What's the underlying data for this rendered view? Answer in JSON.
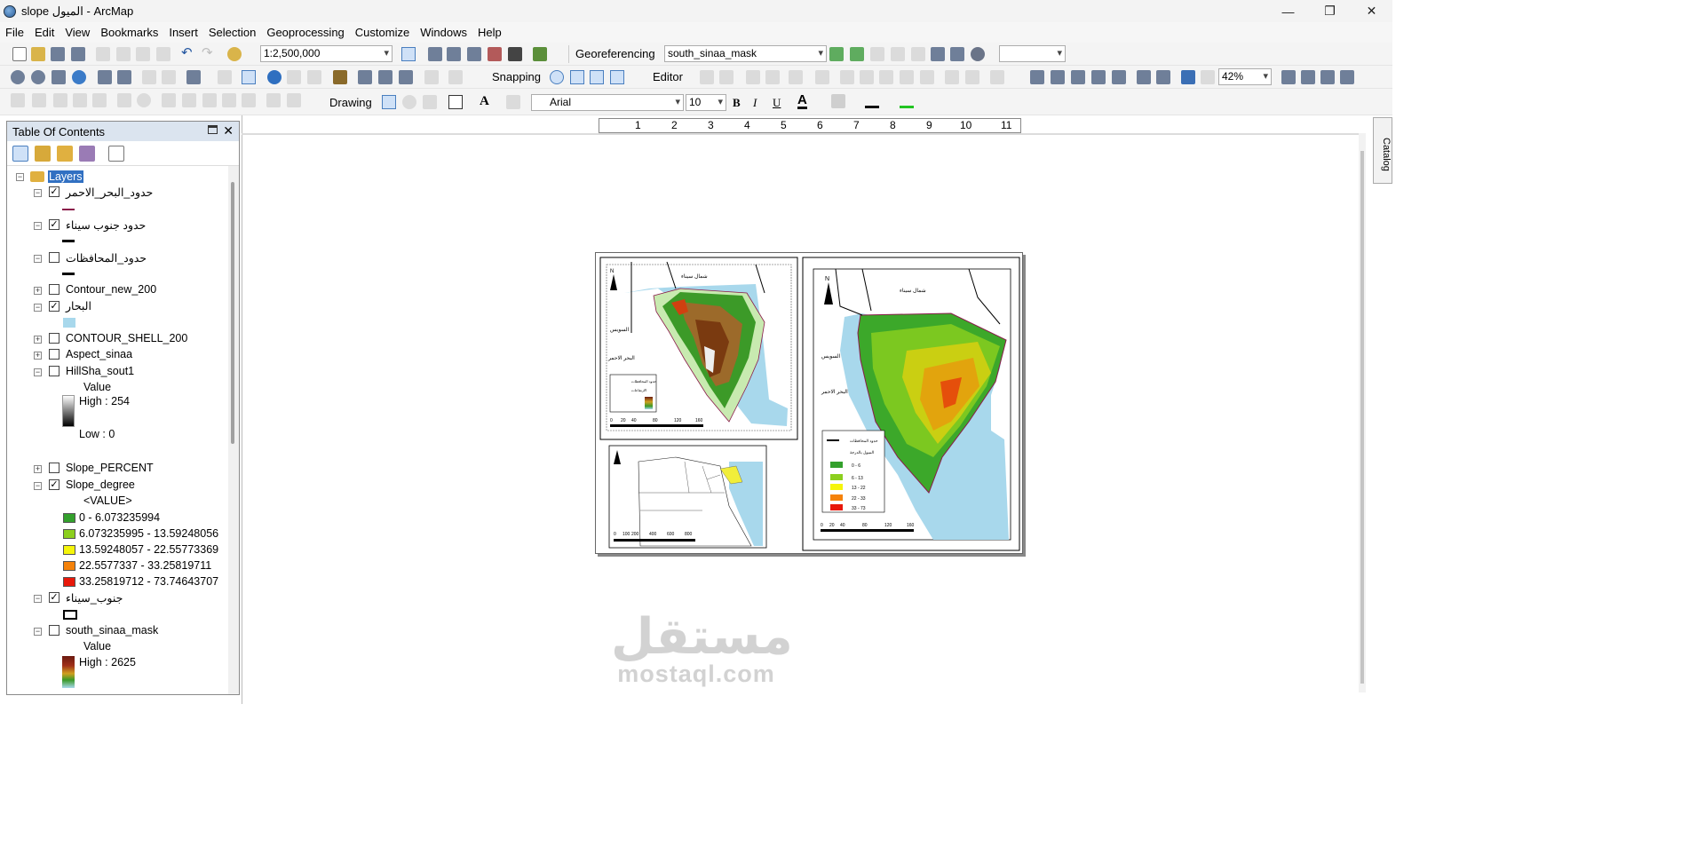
{
  "window": {
    "title": "slope الميول - ArcMap"
  },
  "menu": [
    "File",
    "Edit",
    "View",
    "Bookmarks",
    "Insert",
    "Selection",
    "Geoprocessing",
    "Customize",
    "Windows",
    "Help"
  ],
  "toolbar": {
    "scale": "1:2,500,000",
    "georef_label": "Georeferencing",
    "georef_layer": "south_sinaa_mask",
    "snapping_label": "Snapping",
    "editor_label": "Editor",
    "zoom": "42%",
    "drawing_label": "Drawing",
    "font_name": "Arial",
    "font_size": "10",
    "bold": "B",
    "italic": "I",
    "underline": "U",
    "text_a": "A"
  },
  "toc": {
    "title": "Table Of Contents",
    "root": "Layers",
    "layers": [
      {
        "name": "حدود_البحر_الاحمر",
        "checked": true,
        "expanded": true
      },
      {
        "name": "حدود جنوب سيناء",
        "checked": true,
        "expanded": true
      },
      {
        "name": "حدود_المحافظات",
        "checked": false,
        "expanded": true
      },
      {
        "name": "Contour_new_200",
        "checked": false,
        "expanded": false
      },
      {
        "name": "البحار",
        "checked": true,
        "expanded": true
      },
      {
        "name": "CONTOUR_SHELL_200",
        "checked": false,
        "expanded": false
      },
      {
        "name": "Aspect_sinaa",
        "checked": false,
        "expanded": false
      },
      {
        "name": "HillSha_sout1",
        "checked": false,
        "expanded": true
      },
      {
        "name": "Slope_PERCENT",
        "checked": false,
        "expanded": false
      },
      {
        "name": "Slope_degree",
        "checked": true,
        "expanded": true
      },
      {
        "name": "جنوب_سيناء",
        "checked": true,
        "expanded": true
      },
      {
        "name": "south_sinaa_mask",
        "checked": false,
        "expanded": true
      }
    ],
    "hillshade": {
      "field": "Value",
      "high": "High : 254",
      "low": "Low : 0"
    },
    "slope": {
      "field": "<VALUE>",
      "classes": [
        {
          "label": "0 - 6.073235994",
          "color": "#33a02c"
        },
        {
          "label": "6.073235995 - 13.59248056",
          "color": "#8ccf1e"
        },
        {
          "label": "13.59248057 - 22.55773369",
          "color": "#f5f50a"
        },
        {
          "label": "22.5577337 - 33.25819711",
          "color": "#f5820a"
        },
        {
          "label": "33.25819712 - 73.74643707",
          "color": "#e8180a"
        }
      ]
    },
    "mask": {
      "field": "Value",
      "high": "High : 2625"
    }
  },
  "ruler": [
    "1",
    "2",
    "3",
    "4",
    "5",
    "6",
    "7",
    "8",
    "9",
    "10",
    "11"
  ],
  "catalog_label": "Catalog",
  "layout": {
    "left_map": {
      "north_label": "شمال سيناء",
      "suez": "السويس",
      "red_sea": "البحر الاحمر",
      "legend_title": "حدود المحافظات",
      "legend_sub": "الارتفاعات",
      "scale_ticks": [
        "0",
        "20",
        "40",
        "80",
        "120",
        "160"
      ],
      "scale_unit": "كم"
    },
    "right_map": {
      "north_label": "شمال سيناء",
      "suez": "السويس",
      "red_sea": "البحر الاحمر",
      "legend_title": "حدود المحافظات",
      "legend_sub": "الميول بالدرجة",
      "classes": [
        "0 - 6",
        "6 - 13",
        "13 - 22",
        "22 - 33",
        "33 - 73"
      ],
      "scale_ticks": [
        "0",
        "20",
        "40",
        "80",
        "120",
        "160"
      ],
      "scale_unit": "كم"
    },
    "inset_ticks": [
      "0",
      "100",
      "200",
      "400",
      "600",
      "800"
    ],
    "inset_unit": "كم"
  },
  "watermark": {
    "ar": "مستقل",
    "en": "mostaql.com"
  },
  "colors": {
    "slope_green": "#33a02c",
    "sea_blue": "#a8d8ec",
    "boundary": "#8a1a4a",
    "dem_brown": "#7a3a10",
    "dem_green": "#3c9a28"
  }
}
